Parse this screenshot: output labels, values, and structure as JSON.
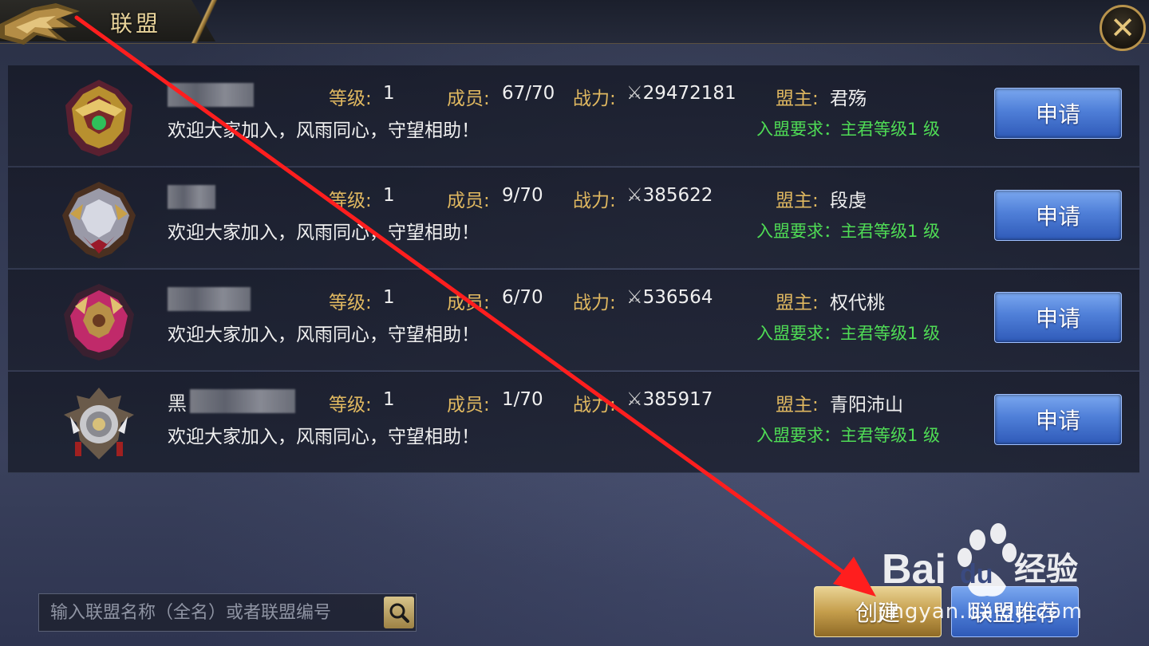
{
  "header": {
    "title": "联盟",
    "close_icon": "close-icon"
  },
  "labels": {
    "level": "等级:",
    "members": "成员:",
    "power": "战力:",
    "leader": "盟主:",
    "power_icon": "crossed-swords-icon"
  },
  "alliances": [
    {
      "name_visible": "",
      "level": "1",
      "members": "67/70",
      "power": "29472181",
      "leader": "君殇",
      "motto": "欢迎大家加入，风雨同心，守望相助！",
      "requirement": "入盟要求：主君等级1 级",
      "apply_label": "申请",
      "badge": "golden-dragon-emblem"
    },
    {
      "name_visible": "",
      "level": "1",
      "members": "9/70",
      "power": "385622",
      "leader": "段虔",
      "motto": "欢迎大家加入，风雨同心，守望相助！",
      "requirement": "入盟要求：主君等级1 级",
      "apply_label": "申请",
      "badge": "silver-dragon-emblem"
    },
    {
      "name_visible": "",
      "level": "1",
      "members": "6/70",
      "power": "536564",
      "leader": "权代桃",
      "motto": "欢迎大家加入，风雨同心，守望相助！",
      "requirement": "入盟要求：主君等级1 级",
      "apply_label": "申请",
      "badge": "crimson-dragon-emblem"
    },
    {
      "name_visible": "黑",
      "level": "1",
      "members": "1/70",
      "power": "385917",
      "leader": "青阳沛山",
      "motto": "欢迎大家加入，风雨同心，守望相助！",
      "requirement": "入盟要求：主君等级1 级",
      "apply_label": "申请",
      "badge": "bronze-shield-emblem"
    }
  ],
  "footer": {
    "search_placeholder": "输入联盟名称（全名）或者联盟编号",
    "search_icon": "search-icon",
    "create_label": "创建",
    "recommend_label": "联盟推荐"
  },
  "watermark": {
    "brand": "Bai",
    "brand2": "du",
    "brand3": "经验",
    "domain": "jingyan.baidu.com"
  },
  "colors": {
    "label_gold": "#e0b860",
    "requirement_green": "#4fdc55",
    "apply_blue": "#4f7fd8",
    "create_gold": "#c59e4c",
    "annotation_red": "#ff1e1e"
  }
}
